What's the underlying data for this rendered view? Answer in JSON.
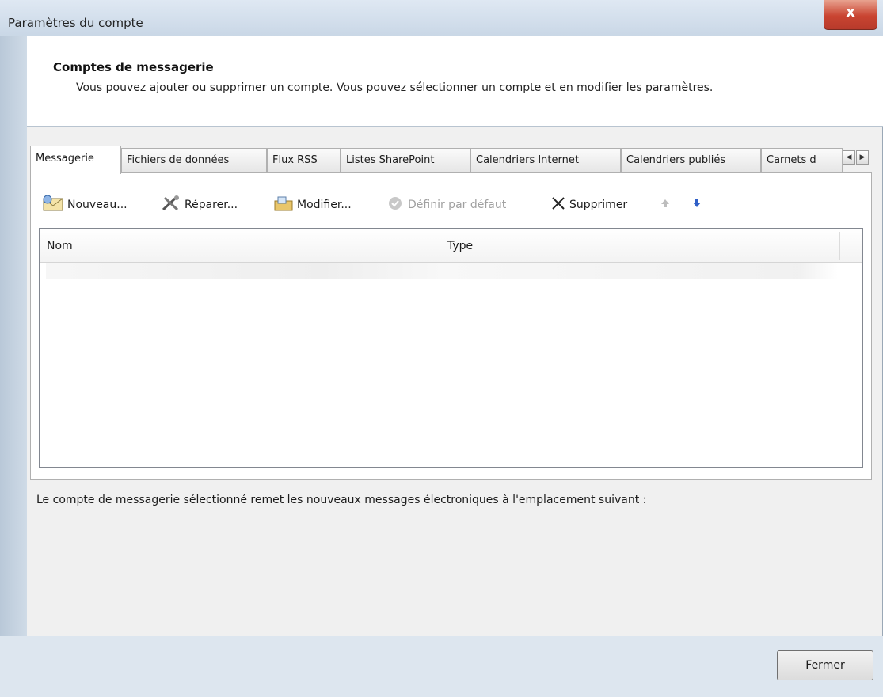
{
  "window": {
    "title": "Paramètres du compte",
    "close_glyph": "x"
  },
  "header": {
    "title": "Comptes de messagerie",
    "description": "Vous pouvez ajouter ou supprimer un compte. Vous pouvez sélectionner un compte et en modifier les paramètres."
  },
  "tabs": [
    {
      "label": "Messagerie",
      "active": true
    },
    {
      "label": "Fichiers de données",
      "active": false
    },
    {
      "label": "Flux RSS",
      "active": false
    },
    {
      "label": "Listes SharePoint",
      "active": false
    },
    {
      "label": "Calendriers Internet",
      "active": false
    },
    {
      "label": "Calendriers publiés",
      "active": false
    },
    {
      "label": "Carnets d",
      "active": false
    }
  ],
  "toolbar": {
    "new_label": "Nouveau...",
    "repair_label": "Réparer...",
    "modify_label": "Modifier...",
    "default_label": "Définir par défaut",
    "delete_label": "Supprimer"
  },
  "list": {
    "columns": [
      "Nom",
      "Type"
    ]
  },
  "info_text": "Le compte de messagerie sélectionné remet les nouveaux messages électroniques à l'emplacement suivant :",
  "footer": {
    "close_label": "Fermer"
  },
  "icons": {
    "new": "envelope-icon",
    "repair": "tools-icon",
    "modify": "folder-edit-icon",
    "default": "checkmark-circle-icon",
    "delete": "x-icon",
    "move_up": "arrow-up-icon",
    "move_down": "arrow-down-icon"
  },
  "colors": {
    "close_button": "#c94431",
    "window_frame": "#d9e4ef",
    "arrow_down": "#2f5fc7"
  }
}
